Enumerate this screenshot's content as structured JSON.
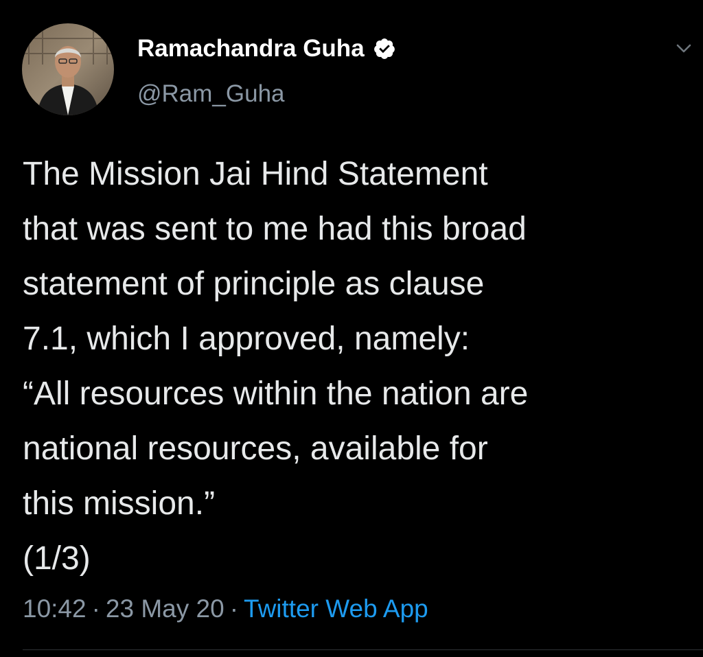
{
  "author": {
    "display_name": "Ramachandra Guha",
    "handle": "@Ram_Guha",
    "verified_icon": "verified-badge-icon",
    "avatar_icon": "profile-photo"
  },
  "menu": {
    "caret_icon": "chevron-down-icon"
  },
  "tweet": {
    "text": "The Mission Jai Hind Statement\nthat was sent to me had this broad\nstatement of principle as clause\n7.1, which I approved, namely:\n“All resources within the nation are\nnational resources, available for\nthis mission.”\n(1/3)",
    "time": "10:42",
    "date": "23 May 20",
    "separator": "·",
    "source": "Twitter Web App"
  },
  "colors": {
    "background": "#000000",
    "text": "#e7e9ea",
    "secondary_text": "#8b98a5",
    "link": "#1d9bf0",
    "verified_badge": "#ffffff"
  }
}
